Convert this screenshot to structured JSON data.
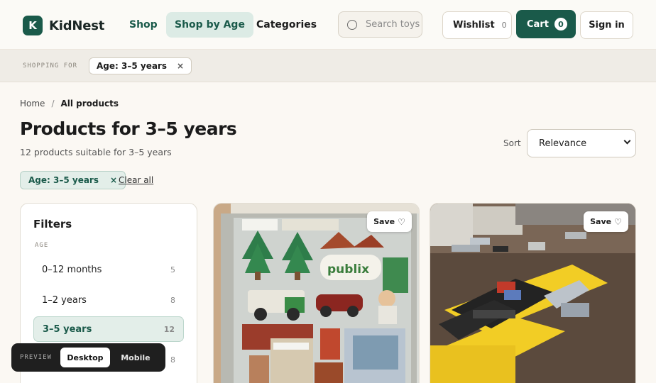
{
  "brand": {
    "initial": "K",
    "name": "KidNest"
  },
  "nav": {
    "shop": "Shop",
    "shop_by_age": "Shop by Age",
    "categories": "Categories"
  },
  "search": {
    "placeholder": "Search toys"
  },
  "header_actions": {
    "wishlist": "Wishlist",
    "wishlist_count": "0",
    "cart": "Cart",
    "cart_count": "0",
    "sign_in": "Sign in"
  },
  "context": {
    "label": "SHOPPING FOR",
    "chip": "Age: 3–5 years",
    "remove": "×"
  },
  "breadcrumb": {
    "home": "Home",
    "sep": "/",
    "current": "All products"
  },
  "page": {
    "title": "Products for 3–5 years",
    "subtitle": "12 products suitable for 3–5 years"
  },
  "sort": {
    "label": "Sort",
    "value": "Relevance"
  },
  "active_filters": {
    "chip": "Age: 3–5 years",
    "remove": "×",
    "clear_all": "Clear all"
  },
  "filters": {
    "title": "Filters",
    "section": "AGE",
    "options": [
      {
        "label": "0–12 months",
        "count": "5"
      },
      {
        "label": "1–2 years",
        "count": "8"
      },
      {
        "label": "3–5 years",
        "count": "12"
      },
      {
        "label": "",
        "count": "8"
      }
    ]
  },
  "products": [
    {
      "save": "Save",
      "heart": "♡"
    },
    {
      "save": "Save",
      "heart": "♡"
    }
  ],
  "preview": {
    "label": "PREVIEW",
    "desktop": "Desktop",
    "mobile": "Mobile"
  },
  "colors": {
    "accent": "#1a5a4a",
    "accent_soft": "#e3eee9",
    "background": "#fbf8f3"
  }
}
